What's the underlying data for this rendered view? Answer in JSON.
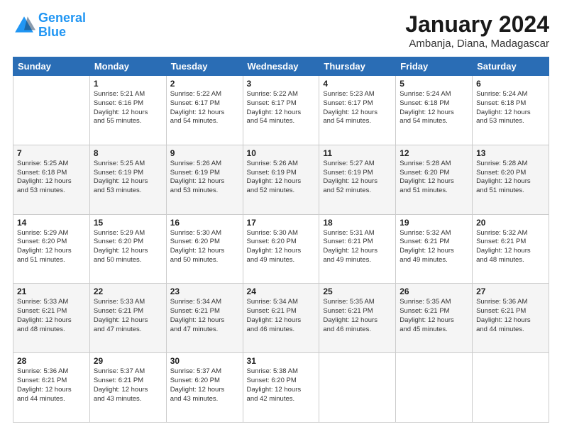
{
  "header": {
    "logo_line1": "General",
    "logo_line2": "Blue",
    "main_title": "January 2024",
    "subtitle": "Ambanja, Diana, Madagascar"
  },
  "calendar": {
    "days_of_week": [
      "Sunday",
      "Monday",
      "Tuesday",
      "Wednesday",
      "Thursday",
      "Friday",
      "Saturday"
    ],
    "weeks": [
      [
        {
          "day": "",
          "info": ""
        },
        {
          "day": "1",
          "info": "Sunrise: 5:21 AM\nSunset: 6:16 PM\nDaylight: 12 hours\nand 55 minutes."
        },
        {
          "day": "2",
          "info": "Sunrise: 5:22 AM\nSunset: 6:17 PM\nDaylight: 12 hours\nand 54 minutes."
        },
        {
          "day": "3",
          "info": "Sunrise: 5:22 AM\nSunset: 6:17 PM\nDaylight: 12 hours\nand 54 minutes."
        },
        {
          "day": "4",
          "info": "Sunrise: 5:23 AM\nSunset: 6:17 PM\nDaylight: 12 hours\nand 54 minutes."
        },
        {
          "day": "5",
          "info": "Sunrise: 5:24 AM\nSunset: 6:18 PM\nDaylight: 12 hours\nand 54 minutes."
        },
        {
          "day": "6",
          "info": "Sunrise: 5:24 AM\nSunset: 6:18 PM\nDaylight: 12 hours\nand 53 minutes."
        }
      ],
      [
        {
          "day": "7",
          "info": "Sunrise: 5:25 AM\nSunset: 6:18 PM\nDaylight: 12 hours\nand 53 minutes."
        },
        {
          "day": "8",
          "info": "Sunrise: 5:25 AM\nSunset: 6:19 PM\nDaylight: 12 hours\nand 53 minutes."
        },
        {
          "day": "9",
          "info": "Sunrise: 5:26 AM\nSunset: 6:19 PM\nDaylight: 12 hours\nand 53 minutes."
        },
        {
          "day": "10",
          "info": "Sunrise: 5:26 AM\nSunset: 6:19 PM\nDaylight: 12 hours\nand 52 minutes."
        },
        {
          "day": "11",
          "info": "Sunrise: 5:27 AM\nSunset: 6:19 PM\nDaylight: 12 hours\nand 52 minutes."
        },
        {
          "day": "12",
          "info": "Sunrise: 5:28 AM\nSunset: 6:20 PM\nDaylight: 12 hours\nand 51 minutes."
        },
        {
          "day": "13",
          "info": "Sunrise: 5:28 AM\nSunset: 6:20 PM\nDaylight: 12 hours\nand 51 minutes."
        }
      ],
      [
        {
          "day": "14",
          "info": "Sunrise: 5:29 AM\nSunset: 6:20 PM\nDaylight: 12 hours\nand 51 minutes."
        },
        {
          "day": "15",
          "info": "Sunrise: 5:29 AM\nSunset: 6:20 PM\nDaylight: 12 hours\nand 50 minutes."
        },
        {
          "day": "16",
          "info": "Sunrise: 5:30 AM\nSunset: 6:20 PM\nDaylight: 12 hours\nand 50 minutes."
        },
        {
          "day": "17",
          "info": "Sunrise: 5:30 AM\nSunset: 6:20 PM\nDaylight: 12 hours\nand 49 minutes."
        },
        {
          "day": "18",
          "info": "Sunrise: 5:31 AM\nSunset: 6:21 PM\nDaylight: 12 hours\nand 49 minutes."
        },
        {
          "day": "19",
          "info": "Sunrise: 5:32 AM\nSunset: 6:21 PM\nDaylight: 12 hours\nand 49 minutes."
        },
        {
          "day": "20",
          "info": "Sunrise: 5:32 AM\nSunset: 6:21 PM\nDaylight: 12 hours\nand 48 minutes."
        }
      ],
      [
        {
          "day": "21",
          "info": "Sunrise: 5:33 AM\nSunset: 6:21 PM\nDaylight: 12 hours\nand 48 minutes."
        },
        {
          "day": "22",
          "info": "Sunrise: 5:33 AM\nSunset: 6:21 PM\nDaylight: 12 hours\nand 47 minutes."
        },
        {
          "day": "23",
          "info": "Sunrise: 5:34 AM\nSunset: 6:21 PM\nDaylight: 12 hours\nand 47 minutes."
        },
        {
          "day": "24",
          "info": "Sunrise: 5:34 AM\nSunset: 6:21 PM\nDaylight: 12 hours\nand 46 minutes."
        },
        {
          "day": "25",
          "info": "Sunrise: 5:35 AM\nSunset: 6:21 PM\nDaylight: 12 hours\nand 46 minutes."
        },
        {
          "day": "26",
          "info": "Sunrise: 5:35 AM\nSunset: 6:21 PM\nDaylight: 12 hours\nand 45 minutes."
        },
        {
          "day": "27",
          "info": "Sunrise: 5:36 AM\nSunset: 6:21 PM\nDaylight: 12 hours\nand 44 minutes."
        }
      ],
      [
        {
          "day": "28",
          "info": "Sunrise: 5:36 AM\nSunset: 6:21 PM\nDaylight: 12 hours\nand 44 minutes."
        },
        {
          "day": "29",
          "info": "Sunrise: 5:37 AM\nSunset: 6:21 PM\nDaylight: 12 hours\nand 43 minutes."
        },
        {
          "day": "30",
          "info": "Sunrise: 5:37 AM\nSunset: 6:20 PM\nDaylight: 12 hours\nand 43 minutes."
        },
        {
          "day": "31",
          "info": "Sunrise: 5:38 AM\nSunset: 6:20 PM\nDaylight: 12 hours\nand 42 minutes."
        },
        {
          "day": "",
          "info": ""
        },
        {
          "day": "",
          "info": ""
        },
        {
          "day": "",
          "info": ""
        }
      ]
    ]
  }
}
